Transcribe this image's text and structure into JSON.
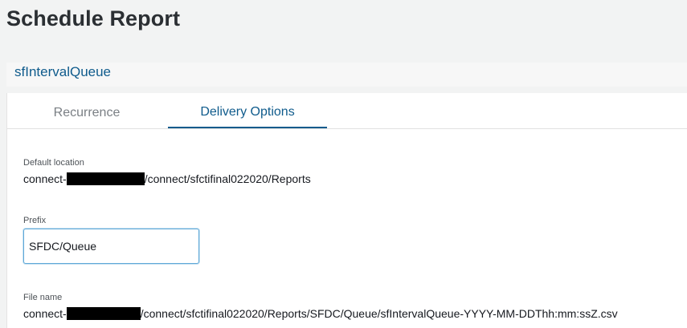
{
  "page": {
    "title": "Schedule Report"
  },
  "report": {
    "name": "sfIntervalQueue"
  },
  "tabs": [
    {
      "label": "Recurrence",
      "active": false
    },
    {
      "label": "Delivery Options",
      "active": true
    }
  ],
  "delivery": {
    "default_location": {
      "label": "Default location",
      "prefix_text": "connect-",
      "suffix_text": "/connect/sfctifinal022020/Reports"
    },
    "prefix": {
      "label": "Prefix",
      "value": "SFDC/Queue"
    },
    "file_name": {
      "label": "File name",
      "prefix_text": "connect-",
      "suffix_text": "/connect/sfctifinal022020/Reports/SFDC/Queue/sfIntervalQueue-YYYY-MM-DDThh:mm:ssZ.csv"
    }
  },
  "colors": {
    "accent": "#0f5b8c",
    "focus_border": "#5fa8d8",
    "background": "#f2f3f3",
    "redaction": "#000000"
  }
}
